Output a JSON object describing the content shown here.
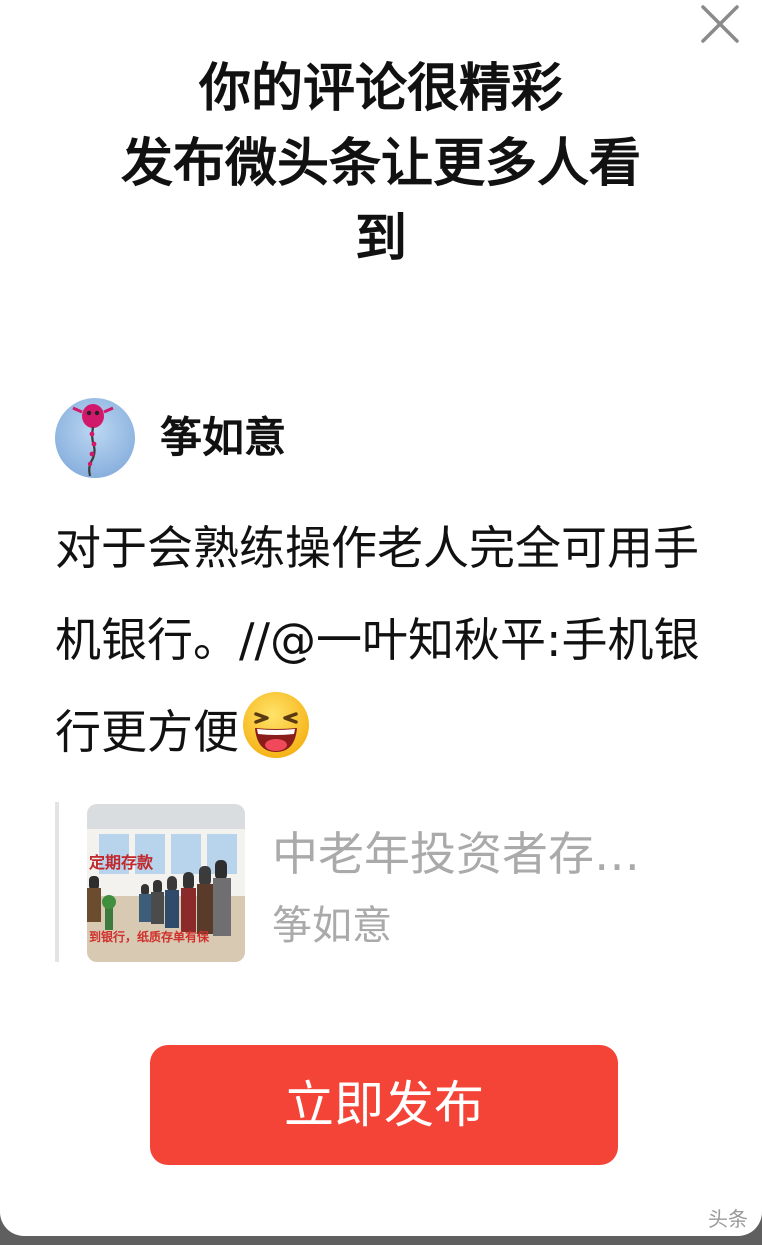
{
  "dialog": {
    "title_line1": "你的评论很精彩",
    "title_line2": "发布微头条让更多人看",
    "title_line3": "到",
    "close_icon": "close-icon"
  },
  "author": {
    "name": "筝如意",
    "avatar_icon": "kite-avatar"
  },
  "comment": {
    "text": "对于会熟练操作老人完全可用手机银行。//@一叶知秋平:手机银行更方便",
    "emoji": "laughing-emoji"
  },
  "quote": {
    "title": "中老年投资者存…",
    "author": "筝如意",
    "thumbnail_text1": "定期存款",
    "thumbnail_text2": "到银行，纸质存单有保"
  },
  "actions": {
    "publish_label": "立即发布"
  },
  "watermark": "头条"
}
